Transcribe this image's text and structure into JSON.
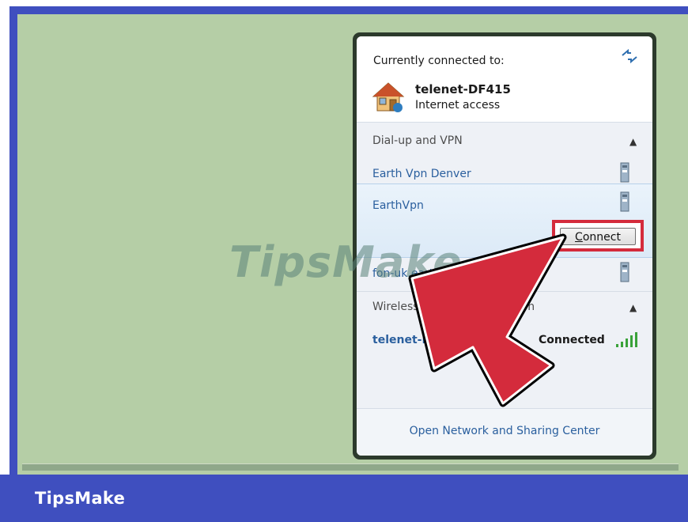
{
  "brand": {
    "footer_text": "TipsMake",
    "watermark_text": "TipsMake"
  },
  "colors": {
    "frame": "#3f4fbf",
    "desktop": "#b5cea6",
    "link": "#2a5f9e",
    "highlight": "#d42b3c",
    "arrow": "#d42b3c"
  },
  "popup": {
    "connected": {
      "label": "Currently connected to:",
      "refresh_icon": "refresh-icon",
      "network_icon": "house-icon",
      "network_name": "telenet-DF415",
      "network_status": "Internet access"
    },
    "vpn_group": {
      "label": "Dial-up and VPN",
      "chevron_icon": "chevron-up-icon",
      "items": [
        {
          "label": "Earth Vpn Denver",
          "icon": "vpn-icon"
        },
        {
          "label": "EarthVpn",
          "icon": "vpn-icon",
          "selected": true
        },
        {
          "label": "fon-uk.earthvpn.com",
          "icon": "vpn-icon"
        }
      ],
      "connect_button": {
        "label_underline": "C",
        "label_rest": "onnect"
      }
    },
    "wireless_group": {
      "label": "Wireless Network Connection",
      "chevron_icon": "chevron-up-icon",
      "network": {
        "name": "telenet-DF415",
        "status": "Connected",
        "icon": "signal-strength-icon"
      }
    },
    "footer_link": "Open Network and Sharing Center"
  }
}
